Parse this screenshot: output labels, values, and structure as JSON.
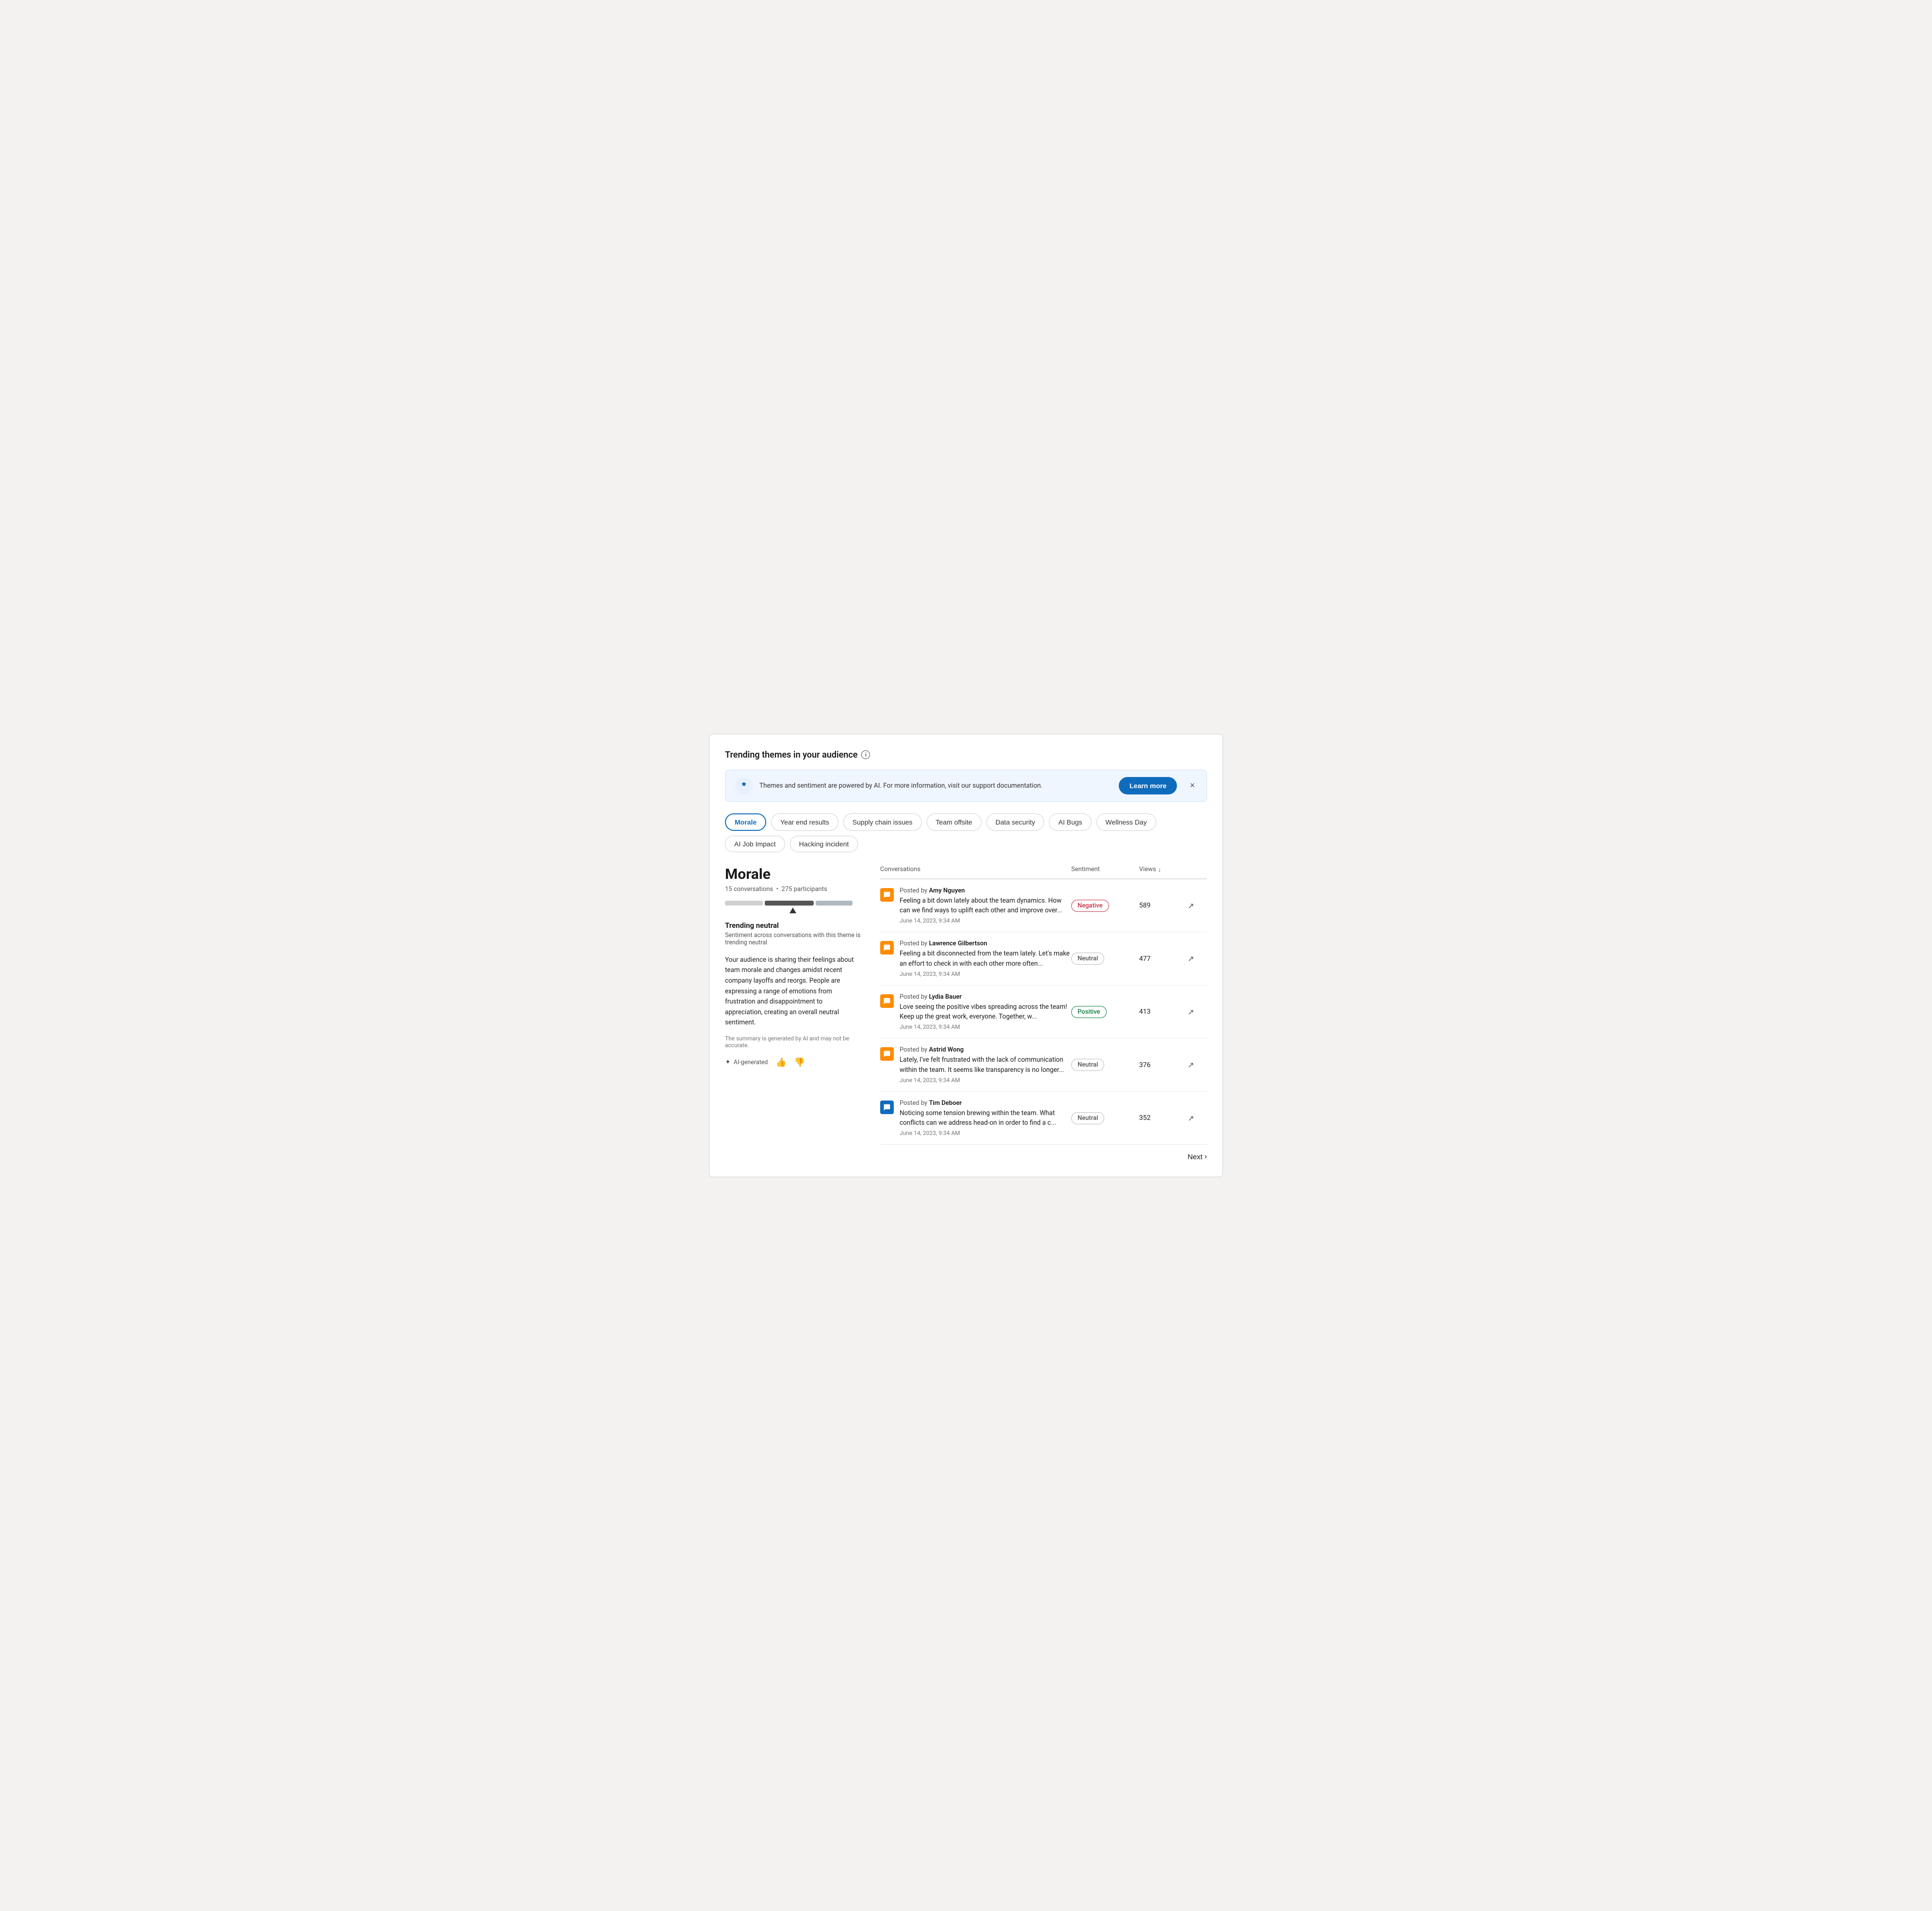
{
  "page": {
    "title": "Trending themes in your audience",
    "banner": {
      "text": "Themes and sentiment are powered by AI. For more information, visit our support documentation.",
      "learn_more": "Learn more",
      "close_label": "×"
    },
    "themes": [
      {
        "id": "morale",
        "label": "Morale",
        "active": true
      },
      {
        "id": "year-end-results",
        "label": "Year end results",
        "active": false
      },
      {
        "id": "supply-chain-issues",
        "label": "Supply chain issues",
        "active": false
      },
      {
        "id": "team-offsite",
        "label": "Team offsite",
        "active": false
      },
      {
        "id": "data-security",
        "label": "Data security",
        "active": false
      },
      {
        "id": "ai-bugs",
        "label": "AI Bugs",
        "active": false
      },
      {
        "id": "wellness-day",
        "label": "Wellness Day",
        "active": false
      },
      {
        "id": "ai-job-impact",
        "label": "AI Job Impact",
        "active": false
      },
      {
        "id": "hacking-incident",
        "label": "Hacking incident",
        "active": false
      }
    ],
    "left_panel": {
      "theme_name": "Morale",
      "conversations_count": "15 conversations",
      "participants_count": "275 participants",
      "trending_label": "Trending neutral",
      "trending_sublabel": "Sentiment across conversations with this theme is trending neutral",
      "summary": "Your audience is sharing their feelings about team morale and changes amidst recent company layoffs and reorgs. People are expressing a range of emotions from frustration and disappointment to appreciation, creating an overall neutral sentiment.",
      "ai_note": "The summary is generated by AI and may not be accurate.",
      "ai_generated": "AI-generated",
      "thumbs_up": "👍",
      "thumbs_down": "👎",
      "bar": {
        "negative_width": 28,
        "neutral_width": 36,
        "positive_width": 27
      }
    },
    "right_panel": {
      "columns": {
        "conversations": "Conversations",
        "sentiment": "Sentiment",
        "views": "Views",
        "views_sort": "↓"
      },
      "rows": [
        {
          "author": "Amy Nguyen",
          "icon_color": "orange",
          "body": "Feeling a bit down lately about the team dynamics. How can we find ways to uplift each other and improve over...",
          "date": "June 14, 2023, 9:34 AM",
          "sentiment": "Negative",
          "sentiment_class": "negative",
          "views": "589"
        },
        {
          "author": "Lawrence Gilbertson",
          "icon_color": "orange",
          "body": "Feeling a bit disconnected from the team lately. Let's make an effort to check in with each other more often...",
          "date": "June 14, 2023, 9:34 AM",
          "sentiment": "Neutral",
          "sentiment_class": "neutral",
          "views": "477"
        },
        {
          "author": "Lydia Bauer",
          "icon_color": "orange",
          "body": "Love seeing the positive vibes spreading across the team! Keep up the great work, everyone. Together, w...",
          "date": "June 14, 2023, 9:34 AM",
          "sentiment": "Positive",
          "sentiment_class": "positive",
          "views": "413"
        },
        {
          "author": "Astrid Wong",
          "icon_color": "orange",
          "body": "Lately, I've felt frustrated with the lack of communication within the team. It seems like transparency is no longer...",
          "date": "June 14, 2023, 9:34 AM",
          "sentiment": "Neutral",
          "sentiment_class": "neutral",
          "views": "376"
        },
        {
          "author": "Tim Deboer",
          "icon_color": "blue",
          "body": "Noticing some tension brewing within the team. What conflicts can we address head-on in order to find a c...",
          "date": "June 14, 2023, 9:34 AM",
          "sentiment": "Neutral",
          "sentiment_class": "neutral",
          "views": "352"
        }
      ],
      "next_label": "Next"
    }
  }
}
